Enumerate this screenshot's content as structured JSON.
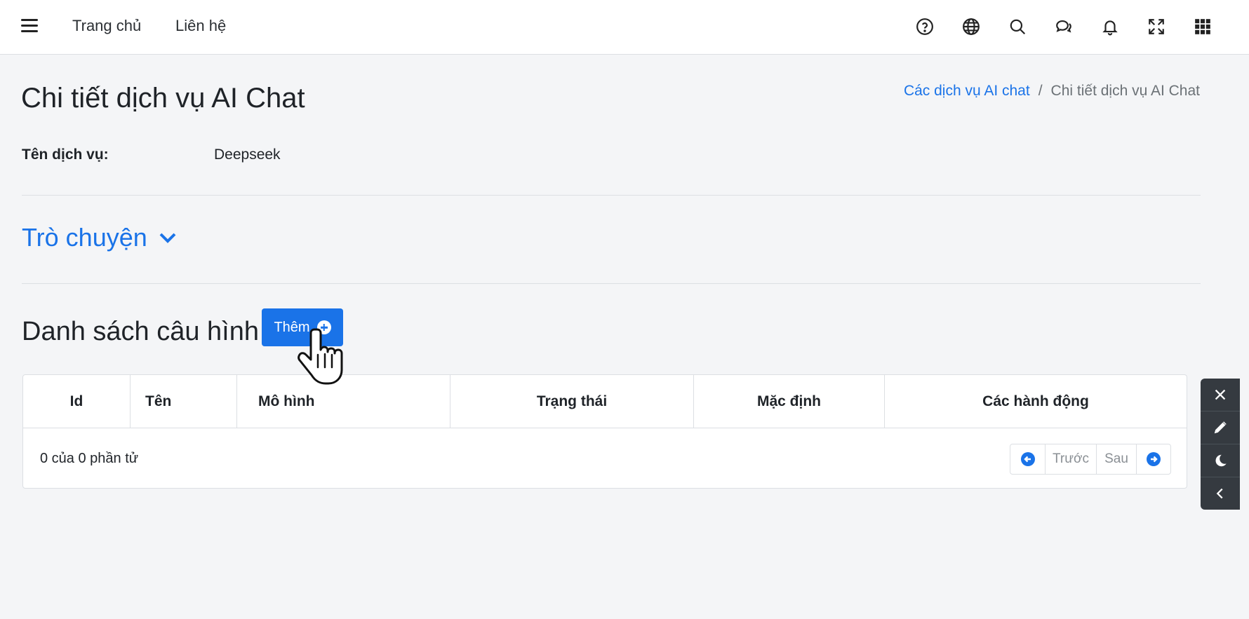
{
  "navbar": {
    "links": [
      {
        "label": "Trang chủ"
      },
      {
        "label": "Liên hệ"
      }
    ],
    "icons": [
      "help-icon",
      "globe-icon",
      "search-icon",
      "chat-icon",
      "bell-icon",
      "fullscreen-icon",
      "apps-grid-icon"
    ]
  },
  "page": {
    "title": "Chi tiết dịch vụ AI Chat",
    "breadcrumb": {
      "parent": "Các dịch vụ AI chat",
      "separator": "/",
      "current": "Chi tiết dịch vụ AI Chat"
    }
  },
  "service": {
    "label": "Tên dịch vụ:",
    "value": "Deepseek"
  },
  "chat_section": {
    "label": "Trò chuyện"
  },
  "config_list": {
    "title": "Danh sách câu hình",
    "add_label": "Thêm",
    "columns": [
      "Id",
      "Tên",
      "Mô hình",
      "Trạng thái",
      "Mặc định",
      "Các hành động"
    ],
    "rows": [],
    "count_text": "0 của 0 phần tử",
    "pager": {
      "prev_label": "Trước",
      "next_label": "Sau"
    }
  },
  "colors": {
    "accent": "#1a73e8",
    "toolbar_bg": "#353a40"
  },
  "float_toolbar": {
    "icons": [
      "close-icon",
      "pencil-icon",
      "moon-icon",
      "chevron-left-icon"
    ]
  }
}
